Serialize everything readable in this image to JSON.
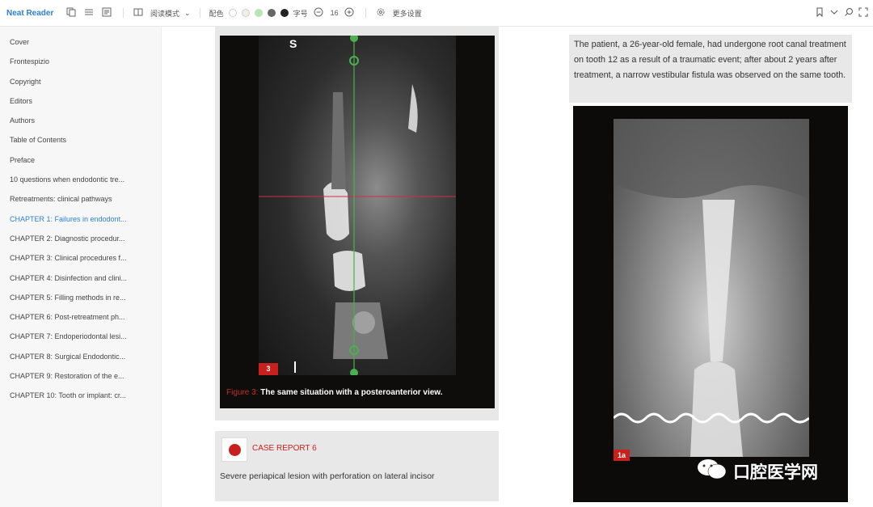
{
  "toolbar": {
    "app_name": "Neat Reader",
    "reading_mode": "阅读模式",
    "color_label": "配色",
    "font_label": "字号",
    "font_size": "16",
    "more_settings": "更多设置"
  },
  "sidebar": {
    "items": [
      {
        "label": "Cover"
      },
      {
        "label": "Frontespizio"
      },
      {
        "label": "Copyright"
      },
      {
        "label": "Editors"
      },
      {
        "label": "Authors"
      },
      {
        "label": "Table of Contents"
      },
      {
        "label": "Preface"
      },
      {
        "label": "10 questions when endodontic tre..."
      },
      {
        "label": "Retreatments: clinical pathways"
      },
      {
        "label": "CHAPTER 1: Failures in endodont..."
      },
      {
        "label": "CHAPTER 2: Diagnostic procedur..."
      },
      {
        "label": "CHAPTER 3: Clinical procedures f..."
      },
      {
        "label": "CHAPTER 4: Disinfection and clini..."
      },
      {
        "label": "CHAPTER 5: Filling methods in re..."
      },
      {
        "label": "CHAPTER 6: Post-retreatment ph..."
      },
      {
        "label": "CHAPTER 7: Endoperiodontal lesi..."
      },
      {
        "label": "CHAPTER 8: Surgical Endodontic..."
      },
      {
        "label": "CHAPTER 9: Restoration of the e..."
      },
      {
        "label": "CHAPTER 10: Tooth or implant: cr..."
      }
    ]
  },
  "figure": {
    "marker": "S",
    "number_badge": "3",
    "caption_label": "Figure 3:",
    "caption_text": "The same situation with a posteroanterior view."
  },
  "case_report": {
    "title": "CASE REPORT 6",
    "text": "Severe periapical lesion with perforation on lateral incisor"
  },
  "main_text": "The patient, a 26-year-old female, had undergone root canal treatment on tooth 12 as a result of a traumatic event; after about 2 years after treatment, a narrow vestibular fistula was observed on the same tooth.",
  "photo": {
    "badge": "1a"
  },
  "watermark": {
    "text": "口腔医学网"
  },
  "colors": {
    "accent": "#2b7fd6",
    "badge_red": "#c8201c",
    "sidebar_bg": "#f7f7f7"
  }
}
